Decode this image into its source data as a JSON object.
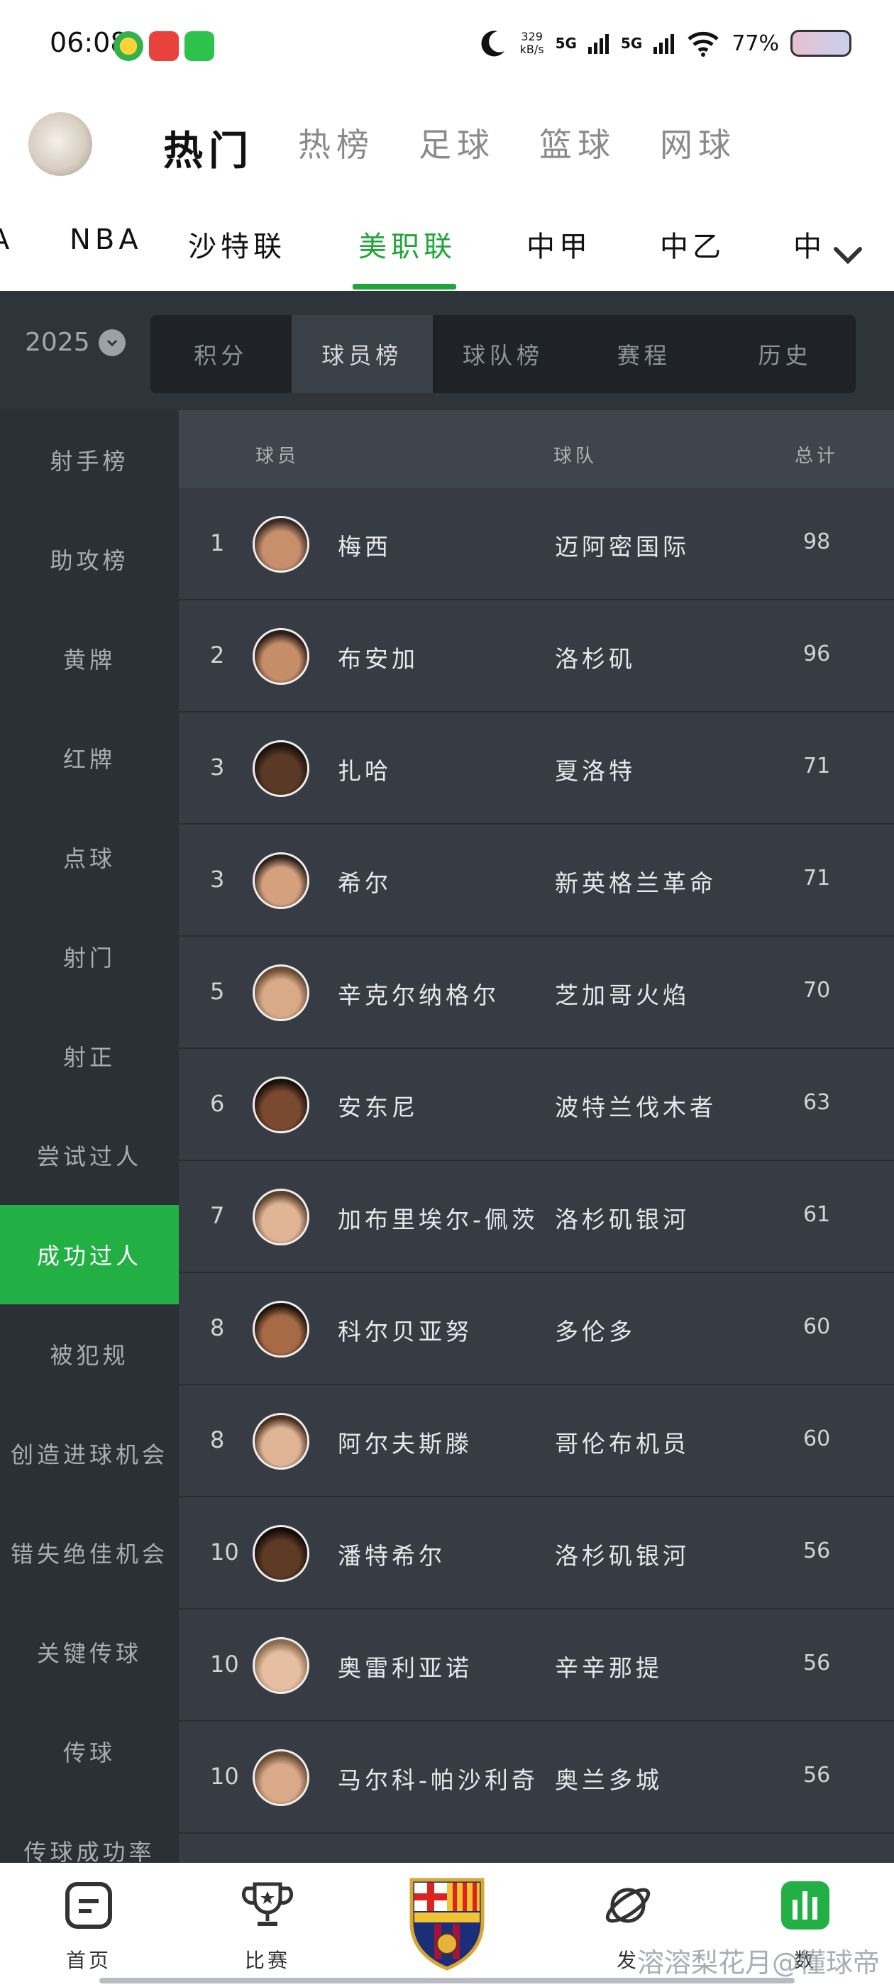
{
  "status": {
    "time": "06:08",
    "net_speed_value": "329",
    "net_speed_unit": "kB/s",
    "signal1": "5G",
    "signal2": "5G",
    "battery": "77%"
  },
  "header": {
    "tabs": [
      "热门",
      "热榜",
      "足球",
      "篮球",
      "网球"
    ]
  },
  "leagues": [
    "A",
    "NBA",
    "沙特联",
    "美职联",
    "中甲",
    "中乙",
    "中"
  ],
  "filter": {
    "year": "2025",
    "segments": [
      "积分",
      "球员榜",
      "球队榜",
      "赛程",
      "历史"
    ]
  },
  "sidebar": [
    "射手榜",
    "助攻榜",
    "黄牌",
    "红牌",
    "点球",
    "射门",
    "射正",
    "尝试过人",
    "成功过人",
    "被犯规",
    "创造进球机会",
    "错失绝佳机会",
    "关键传球",
    "传球",
    "传球成功率"
  ],
  "table": {
    "headers": {
      "player": "球员",
      "team": "球队",
      "total": "总计"
    },
    "rows": [
      {
        "rank": "1",
        "name": "梅西",
        "team": "迈阿密国际",
        "total": "98"
      },
      {
        "rank": "2",
        "name": "布安加",
        "team": "洛杉矶",
        "total": "96"
      },
      {
        "rank": "3",
        "name": "扎哈",
        "team": "夏洛特",
        "total": "71"
      },
      {
        "rank": "3",
        "name": "希尔",
        "team": "新英格兰革命",
        "total": "71"
      },
      {
        "rank": "5",
        "name": "辛克尔纳格尔",
        "team": "芝加哥火焰",
        "total": "70"
      },
      {
        "rank": "6",
        "name": "安东尼",
        "team": "波特兰伐木者",
        "total": "63"
      },
      {
        "rank": "7",
        "name": "加布里埃尔-佩茨",
        "team": "洛杉矶银河",
        "total": "61"
      },
      {
        "rank": "8",
        "name": "科尔贝亚努",
        "team": "多伦多",
        "total": "60"
      },
      {
        "rank": "8",
        "name": "阿尔夫斯滕",
        "team": "哥伦布机员",
        "total": "60"
      },
      {
        "rank": "10",
        "name": "潘特希尔",
        "team": "洛杉矶银河",
        "total": "56"
      },
      {
        "rank": "10",
        "name": "奥雷利亚诺",
        "team": "辛辛那提",
        "total": "56"
      },
      {
        "rank": "10",
        "name": "马尔科-帕沙利奇",
        "team": "奥兰多城",
        "total": "56"
      }
    ]
  },
  "bottom_nav": {
    "items": [
      "首页",
      "比赛",
      "发",
      "数"
    ],
    "watermark": "溶溶梨花月@懂球帝"
  },
  "colors": {
    "accent": "#20a53a",
    "dark_bg": "#373c44",
    "sidebar_bg": "#2b3037"
  }
}
